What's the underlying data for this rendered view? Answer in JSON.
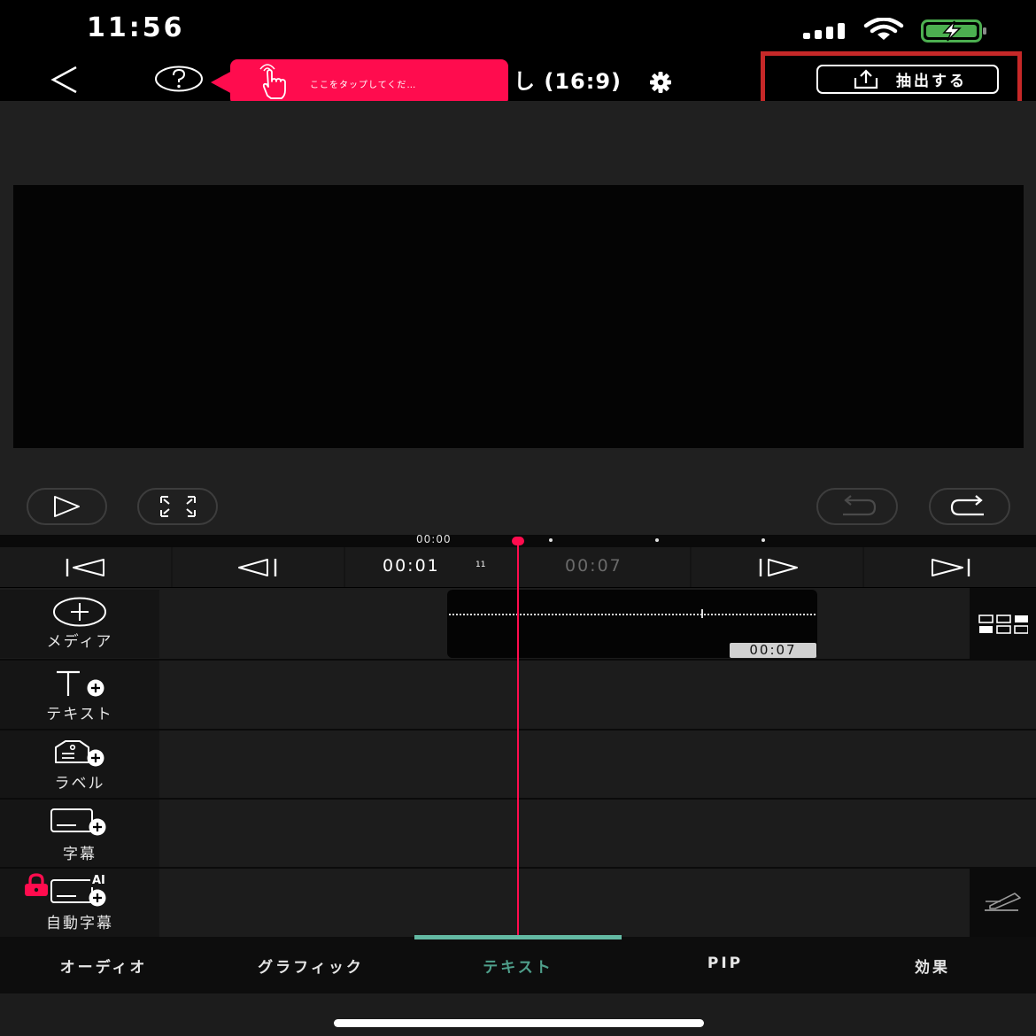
{
  "status_bar": {
    "time": "11:56"
  },
  "header": {
    "tooltip_text": "ここをタップしてくだ…",
    "title": "し (16:9)",
    "export_label": "抽出する"
  },
  "timeline": {
    "ruler_label": "00:00",
    "current_time": "00:01",
    "current_frame": "11",
    "total_time": "00:07",
    "clip_duration": "00:07"
  },
  "tracks": [
    {
      "label": "メディア",
      "icon": "add-media-icon"
    },
    {
      "label": "テキスト",
      "icon": "add-text-icon"
    },
    {
      "label": "ラベル",
      "icon": "add-label-icon"
    },
    {
      "label": "字幕",
      "icon": "add-subtitle-icon"
    },
    {
      "label": "自動字幕",
      "icon": "auto-subtitle-icon",
      "badge": "AI",
      "locked": true
    }
  ],
  "bottom_tabs": [
    {
      "label": "オーディオ"
    },
    {
      "label": "グラフィック"
    },
    {
      "label": "テキスト",
      "active": true
    },
    {
      "label": "PIP"
    },
    {
      "label": "効果"
    }
  ],
  "colors": {
    "accent": "#ff0c4e",
    "active_tab": "#63b9a3",
    "highlight_frame": "#c62828"
  }
}
